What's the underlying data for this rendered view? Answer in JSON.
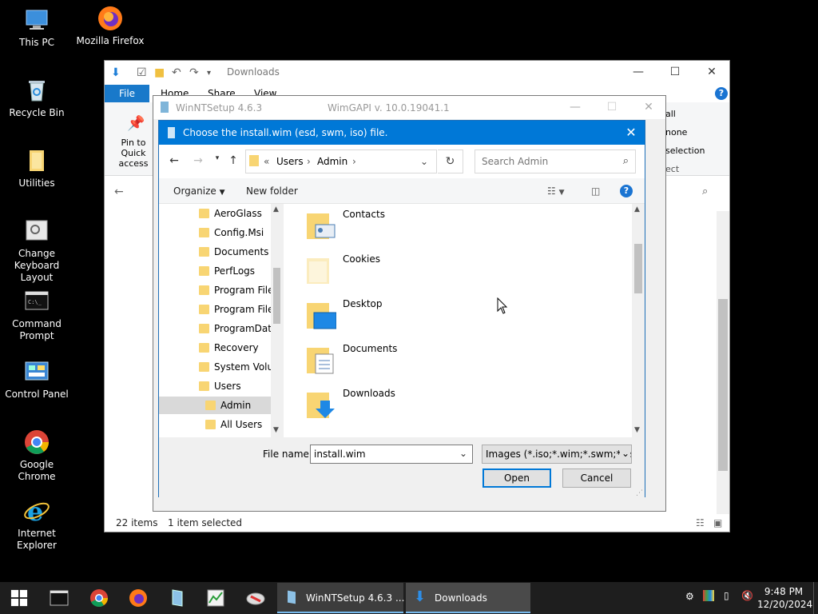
{
  "desktop": {
    "icons": [
      {
        "label": "This PC"
      },
      {
        "label": "Mozilla Firefox"
      },
      {
        "label": "Recycle Bin"
      },
      {
        "label": "Utilities"
      },
      {
        "label": "Change Keyboard Layout"
      },
      {
        "label": "Command Prompt"
      },
      {
        "label": "Control Panel"
      },
      {
        "label": "Google Chrome"
      },
      {
        "label": "Internet Explorer"
      }
    ]
  },
  "explorer": {
    "title": "Downloads",
    "tabs": {
      "file": "File",
      "home": "Home",
      "share": "Share",
      "view": "View"
    },
    "ribbon": {
      "pin": "Pin to Quick access",
      "select_all": "all",
      "select_none": "none",
      "invert": "selection",
      "select": "ect"
    },
    "status": {
      "items": "22 items",
      "selected": "1 item selected"
    }
  },
  "winntsetup": {
    "title": "WinNTSetup 4.6.3",
    "wimgapi": "WimGAPI v. 10.0.19041.1"
  },
  "dialog": {
    "title": "Choose the install.wim (esd, swm, iso) file.",
    "breadcrumb": {
      "prefix": "«",
      "part1": "Users",
      "part2": "Admin"
    },
    "search_placeholder": "Search Admin",
    "toolbar": {
      "organize": "Organize",
      "new_folder": "New folder"
    },
    "tree": [
      {
        "name": "AeroGlass"
      },
      {
        "name": "Config.Msi"
      },
      {
        "name": "Documents a"
      },
      {
        "name": "PerfLogs"
      },
      {
        "name": "Program Files"
      },
      {
        "name": "Program Files"
      },
      {
        "name": "ProgramData"
      },
      {
        "name": "Recovery"
      },
      {
        "name": "System Volun"
      },
      {
        "name": "Users"
      },
      {
        "name": "Admin"
      },
      {
        "name": "All Users"
      }
    ],
    "files": [
      {
        "name": "Contacts"
      },
      {
        "name": "Cookies"
      },
      {
        "name": "Desktop"
      },
      {
        "name": "Documents"
      },
      {
        "name": "Downloads"
      }
    ],
    "file_name_label": "File name:",
    "file_name_value": "install.wim",
    "filter": "Images (*.iso;*.wim;*.swm;*.esd",
    "open": "Open",
    "cancel": "Cancel"
  },
  "taskbar": {
    "tasks": [
      {
        "label": "WinNTSetup 4.6.3   ..."
      },
      {
        "label": "Downloads"
      }
    ],
    "time": "9:48 PM",
    "date": "12/20/2024"
  }
}
